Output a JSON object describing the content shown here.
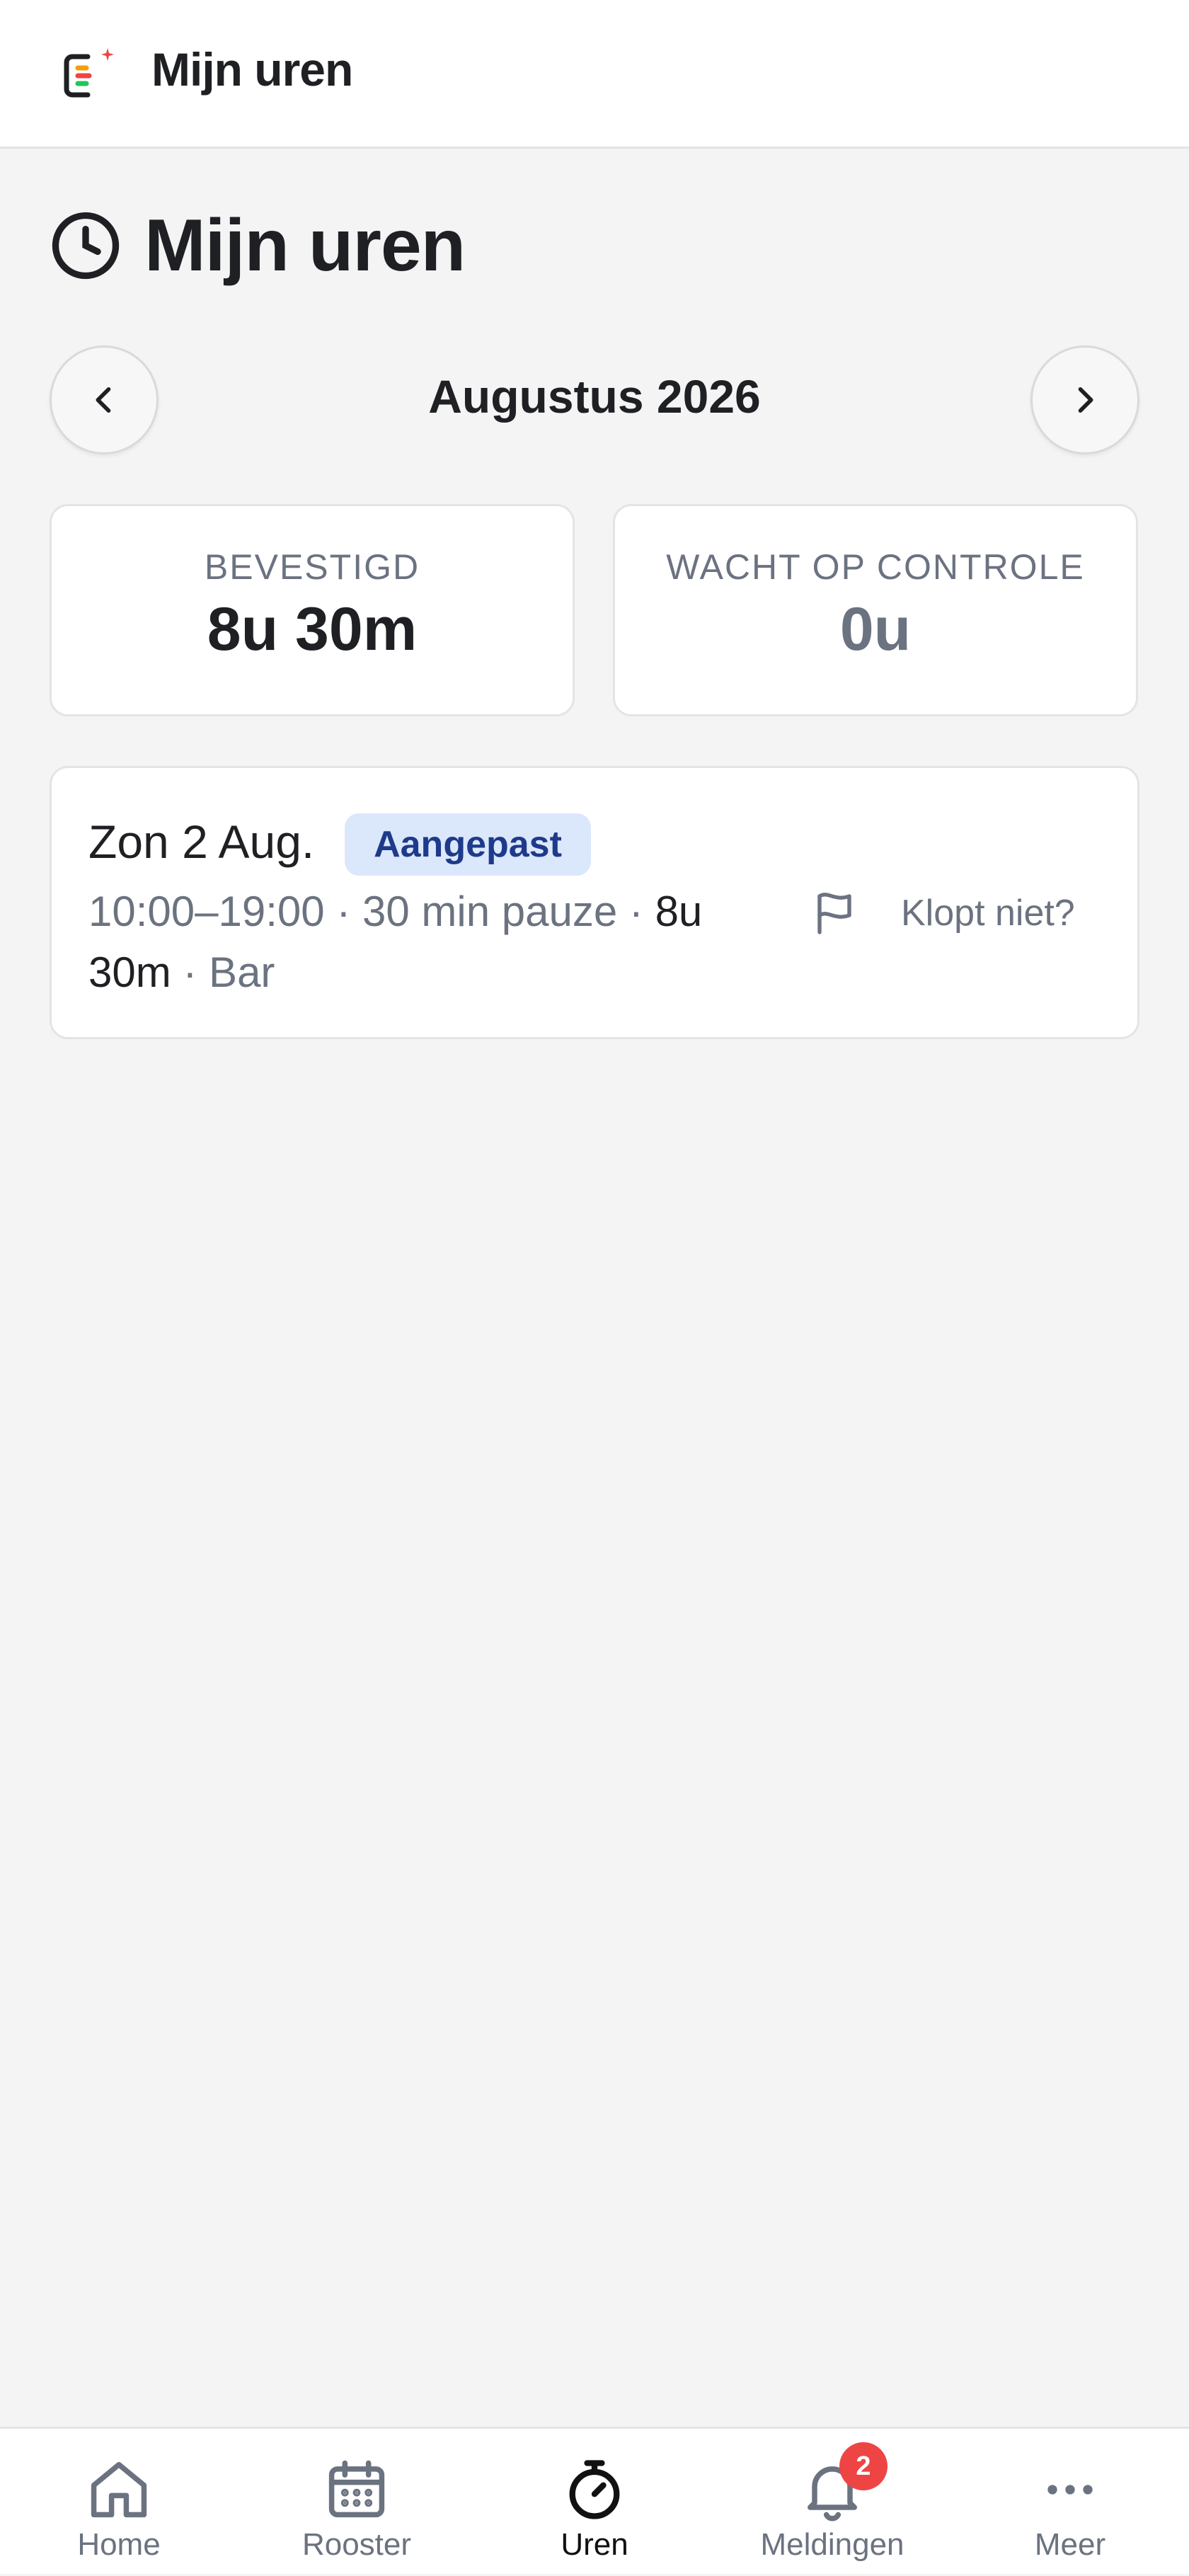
{
  "app": {
    "title": "Mijn uren",
    "logo_icon": "app-logo-icon"
  },
  "page": {
    "heading": "Mijn uren",
    "heading_icon": "clock-icon"
  },
  "month_nav": {
    "prev_icon": "chevron-left-icon",
    "month_label": "Augustus 2026",
    "next_icon": "chevron-right-icon"
  },
  "stats": {
    "confirmed": {
      "label": "BEVESTIGD",
      "value": "8u 30m"
    },
    "pending": {
      "label": "WACHT OP CONTROLE",
      "value": "0u"
    }
  },
  "entries": [
    {
      "date": "Zon 2 Aug.",
      "status": "Aangepast",
      "time": "10:00–19:00",
      "sep1": " · ",
      "pause": "30 min pauze",
      "sep2": " · ",
      "duration": "8u 30m",
      "sep3": " · ",
      "location": "Bar",
      "report_label": "Klopt niet?",
      "report_icon": "flag-icon"
    }
  ],
  "bottom_nav": {
    "items": [
      {
        "label": "Home",
        "icon": "home-icon"
      },
      {
        "label": "Rooster",
        "icon": "calendar-icon"
      },
      {
        "label": "Uren",
        "icon": "stopwatch-icon",
        "active": true
      },
      {
        "label": "Meldingen",
        "icon": "bell-icon",
        "badge": "2"
      },
      {
        "label": "Meer",
        "icon": "more-icon"
      }
    ]
  },
  "colors": {
    "background": "#f4f4f5",
    "badge_bg": "#dbe7fb",
    "badge_text": "#1e3a8a",
    "notification": "#ef4444",
    "muted": "#6b7280"
  }
}
